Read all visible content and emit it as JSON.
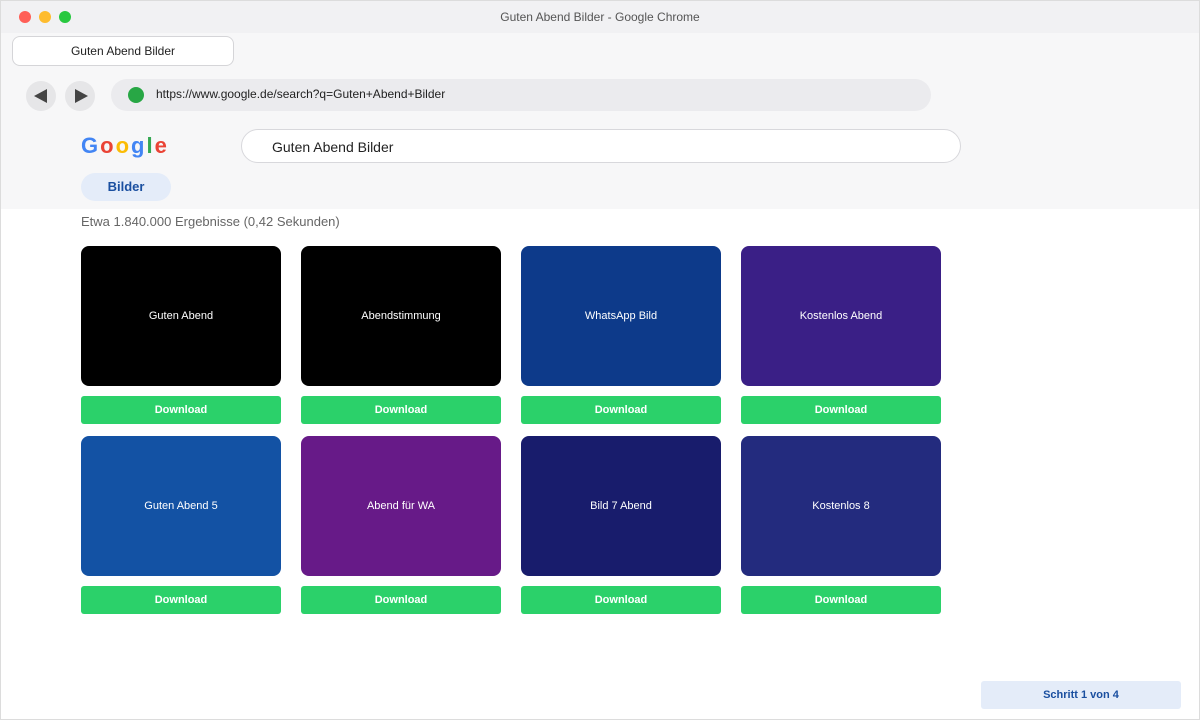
{
  "window": {
    "title": "Guten Abend Bilder - Google Chrome"
  },
  "tab": {
    "label": "Guten Abend Bilder"
  },
  "navigation": {
    "back_icon": "back-arrow-icon",
    "forward_icon": "forward-arrow-icon"
  },
  "urlbar": {
    "url": "https://www.google.de/search?q=Guten+Abend+Bilder",
    "secure_icon": "secure-indicator-icon"
  },
  "search": {
    "query": "Guten Abend Bilder"
  },
  "filters": {
    "images_tab": "Bilder"
  },
  "results": {
    "count_text": "Etwa 1.840.000 Ergebnisse (0,42 Sekunden)",
    "items": [
      {
        "caption": "Guten Abend",
        "color": "#000000",
        "download_label": "Download"
      },
      {
        "caption": "Abendstimmung",
        "color": "#000000",
        "download_label": "Download"
      },
      {
        "caption": "WhatsApp Bild",
        "color": "#0d3a8a",
        "download_label": "Download"
      },
      {
        "caption": "Kostenlos Abend",
        "color": "#3a1f86",
        "download_label": "Download"
      },
      {
        "caption": "Guten Abend 5",
        "color": "#1352a4",
        "download_label": "Download"
      },
      {
        "caption": "Abend für WA",
        "color": "#671a88",
        "download_label": "Download"
      },
      {
        "caption": "Bild 7 Abend",
        "color": "#181c6c",
        "download_label": "Download"
      },
      {
        "caption": "Kostenlos 8",
        "color": "#232b7e",
        "download_label": "Download"
      }
    ]
  },
  "step": {
    "label": "Schritt 1 von 4"
  },
  "colors": {
    "download_green": "#2bd16a",
    "accent_blue": "#1a4fa0"
  }
}
